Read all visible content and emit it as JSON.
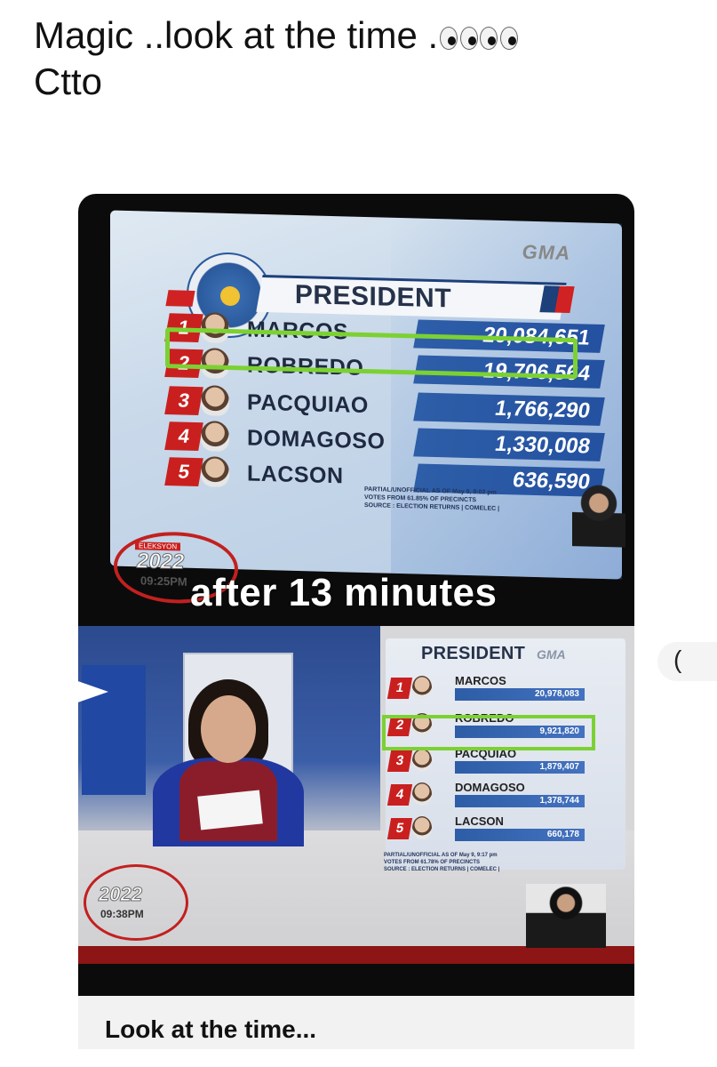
{
  "caption": {
    "line1": "Magic ..look at the time .",
    "line2": "Ctto"
  },
  "top": {
    "brand": "GMA",
    "race": "PRESIDENT",
    "rows": [
      {
        "rank": "1",
        "name": "MARCOS",
        "votes": "20,084,651"
      },
      {
        "rank": "2",
        "name": "ROBREDO",
        "votes": "19,706,564"
      },
      {
        "rank": "3",
        "name": "PACQUIAO",
        "votes": "1,766,290"
      },
      {
        "rank": "4",
        "name": "DOMAGOSO",
        "votes": "1,330,008"
      },
      {
        "rank": "5",
        "name": "LACSON",
        "votes": "636,590"
      }
    ],
    "footnote1": "PARTIAL/UNOFFICIAL AS OF May 9, 9:02 pm",
    "footnote2": "VOTES FROM 61.85% OF PRECINCTS",
    "footnote3": "SOURCE : ELECTION RETURNS | COMELEC |",
    "badge_label": "ELEKSYON",
    "badge_year": "2022",
    "badge_time": "09:25PM"
  },
  "overlay_text": "after 13 minutes",
  "bottom": {
    "brand": "GMA",
    "race": "PRESIDENT",
    "rows": [
      {
        "rank": "1",
        "name": "MARCOS",
        "votes": "20,978,083"
      },
      {
        "rank": "2",
        "name": "ROBREDO",
        "votes": "9,921,820"
      },
      {
        "rank": "3",
        "name": "PACQUIAO",
        "votes": "1,879,407"
      },
      {
        "rank": "4",
        "name": "DOMAGOSO",
        "votes": "1,378,744"
      },
      {
        "rank": "5",
        "name": "LACSON",
        "votes": "660,178"
      }
    ],
    "footnote1": "PARTIAL/UNOFFICIAL AS OF May 9, 9:17 pm",
    "footnote2": "VOTES FROM 61.78% OF PRECINCTS",
    "footnote3": "SOURCE : ELECTION RETURNS | COMELEC |",
    "badge_year": "2022",
    "badge_time": "09:38PM"
  },
  "bottom_caption": "Look at the time...",
  "side_chip": "(",
  "colors": {
    "highlight": "#7cd132",
    "circle": "#c2201f",
    "rank_red": "#c9201f",
    "vote_blue": "#2451a0"
  }
}
